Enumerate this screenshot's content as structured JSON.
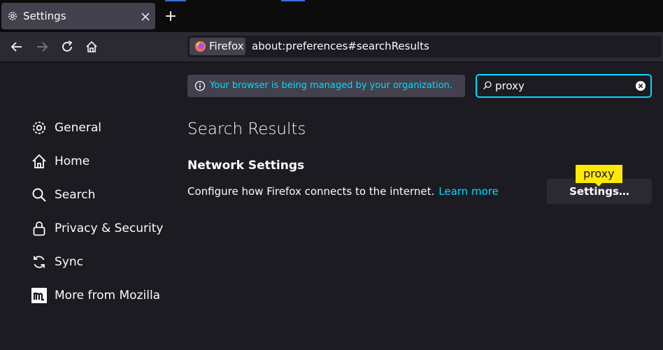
{
  "tab": {
    "title": "Settings"
  },
  "urlbar": {
    "identity_label": "Firefox",
    "url": "about:preferences#searchResults"
  },
  "policy": {
    "text": "Your browser is being managed by your organization."
  },
  "search": {
    "value": "proxy"
  },
  "sidebar": {
    "items": [
      {
        "label": "General",
        "icon": "gear-icon"
      },
      {
        "label": "Home",
        "icon": "home-icon"
      },
      {
        "label": "Search",
        "icon": "search-icon"
      },
      {
        "label": "Privacy & Security",
        "icon": "lock-icon"
      },
      {
        "label": "Sync",
        "icon": "sync-icon"
      },
      {
        "label": "More from Mozilla",
        "icon": "mozilla-icon"
      }
    ]
  },
  "results": {
    "title": "Search Results",
    "section_title": "Network Settings",
    "description": "Configure how Firefox connects to the internet.",
    "learn_more": "Learn more",
    "highlight": "proxy",
    "button_label": "Settings…"
  },
  "colors": {
    "accent": "#00ddff",
    "highlight": "#ffe900",
    "background": "#1c1b22"
  }
}
